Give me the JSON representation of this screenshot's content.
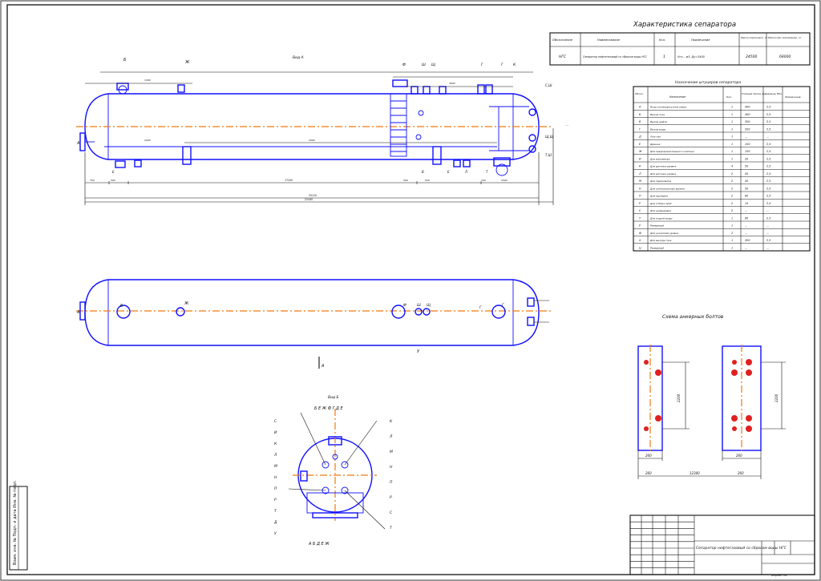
{
  "drawing": {
    "title": "Характеристика сепаратора",
    "view_a_label": "Вид А",
    "view_b_label": "Вид Б",
    "side_label": "А",
    "bolt_scheme_title": "Схема анкерных болтов",
    "nozzle_table_title": "Назначение штуцеров сепаратора",
    "stamp_text": "Сепаратор нефтегазовый со сбросом воды НГС",
    "corner_stamp": "Формат А1",
    "vertical_stamp": "Взам. инв. № Подп. и дата Инв. № подл."
  },
  "spec_table": {
    "headers": [
      "Обозначение",
      "Наименование",
      "Кол.",
      "Примечание",
      "Масса порожнего, кг",
      "Масса при заполнении, кг"
    ],
    "row": [
      "НГС",
      "Сепаратор нефтегазовый со сбросом воды НГС",
      "1",
      "Vн=…м3, Ду=3400",
      "24500",
      "68000"
    ]
  },
  "nozzle_table": {
    "headers": [
      "Обозн.",
      "Назначение",
      "Кол.",
      "Условный проход, Ду",
      "Давление, МПа",
      "Примечание"
    ],
    "rows": [
      {
        "id": "А",
        "name": "Вход газожидкостной смеси",
        "qty": "1",
        "dn": "400",
        "pn": "2,5"
      },
      {
        "id": "Б",
        "name": "Выход газа",
        "qty": "1",
        "dn": "400",
        "pn": "2,5"
      },
      {
        "id": "В",
        "name": "Выход нефти",
        "qty": "1",
        "dn": "300",
        "pn": "2,5"
      },
      {
        "id": "Г",
        "name": "Выход воды",
        "qty": "1",
        "dn": "200",
        "pn": "2,5"
      },
      {
        "id": "Д",
        "name": "Люк-лаз",
        "qty": "1",
        "dn": "…",
        "pn": "…"
      },
      {
        "id": "Е",
        "name": "Дренаж",
        "qty": "1",
        "dn": "100",
        "pn": "2,5"
      },
      {
        "id": "Ж",
        "name": "Для предохранительного клапана",
        "qty": "1",
        "dn": "150",
        "pn": "2,5"
      },
      {
        "id": "И",
        "name": "Для манометра",
        "qty": "1",
        "dn": "20",
        "pn": "2,5"
      },
      {
        "id": "К",
        "name": "Для датчика уровня",
        "qty": "4",
        "dn": "50",
        "pn": "2,5"
      },
      {
        "id": "Л",
        "name": "Для датчика уровня",
        "qty": "2",
        "dn": "50",
        "pn": "2,5"
      },
      {
        "id": "М",
        "name": "Для термометра",
        "qty": "2",
        "dn": "50",
        "pn": "2,5"
      },
      {
        "id": "Н",
        "name": "Для сигнализатора уровня",
        "qty": "2",
        "dn": "50",
        "pn": "2,5"
      },
      {
        "id": "П",
        "name": "Для пропарки",
        "qty": "2",
        "dn": "80",
        "pn": "2,5"
      },
      {
        "id": "Р",
        "name": "Для отбора проб",
        "qty": "2",
        "dn": "15",
        "pn": "2,5"
      },
      {
        "id": "С",
        "name": "Для уровнемера",
        "qty": "2",
        "dn": "…",
        "pn": "…"
      },
      {
        "id": "Т",
        "name": "Для подачи воды",
        "qty": "1",
        "dn": "80",
        "pn": "2,5"
      },
      {
        "id": "У",
        "name": "Резервный",
        "qty": "1",
        "dn": "…",
        "pn": "…"
      },
      {
        "id": "Ф",
        "name": "Для указателя уровня",
        "qty": "2",
        "dn": "…",
        "pn": "…"
      },
      {
        "id": "Х",
        "name": "Для выхода газа",
        "qty": "1",
        "dn": "200",
        "pn": "2,5"
      },
      {
        "id": "Ц",
        "name": "Резервный",
        "qty": "1",
        "dn": "…",
        "pn": "…"
      }
    ]
  },
  "front_view": {
    "nozzle_labels_top": [
      "Б",
      "Ж",
      "Ф",
      "Ш",
      "Щ",
      "Г",
      "Г",
      "К"
    ],
    "nozzle_labels_bottom": [
      "Е",
      "В",
      "Е",
      "Л",
      "Т",
      "М"
    ],
    "nozzle_labels_right": [
      "С,Ш",
      "Щ,Щ",
      "Т,Ш"
    ],
    "left_label": "А",
    "dim_total": "20120",
    "dim_shell": "17200",
    "dim_overall": "22440",
    "dim_small": [
      "750",
      "500",
      "1300",
      "2000",
      "500",
      "500",
      "3600",
      "700",
      "1500",
      "1000"
    ]
  },
  "top_view": {
    "labels": [
      "Б",
      "Ж",
      "Ф",
      "Ш",
      "Щ",
      "Г",
      "Г",
      "А",
      "У"
    ]
  },
  "view_b": {
    "top_letters": "Б Е Ж Ф Г Д Е",
    "bottom_letters": "А Б Д Е Ж",
    "left_letters": [
      "С",
      "И",
      "К",
      "Л",
      "М",
      "Н",
      "П",
      "Р",
      "Т",
      "Д",
      "У"
    ],
    "right_letters": [
      "К",
      "Л",
      "М",
      "Н",
      "П",
      "Р",
      "С",
      "Т"
    ]
  },
  "bolts": {
    "dim_a": "2200",
    "dim_b": "2200",
    "dim_w1": "260",
    "dim_w2": "260",
    "dim_between": "12300",
    "dim_bottom1": "260",
    "dim_bottom2": "260"
  },
  "colors": {
    "outline": "#1010ff",
    "axis": "#f07a10",
    "frame": "#111111",
    "bolt": "#e02020"
  }
}
